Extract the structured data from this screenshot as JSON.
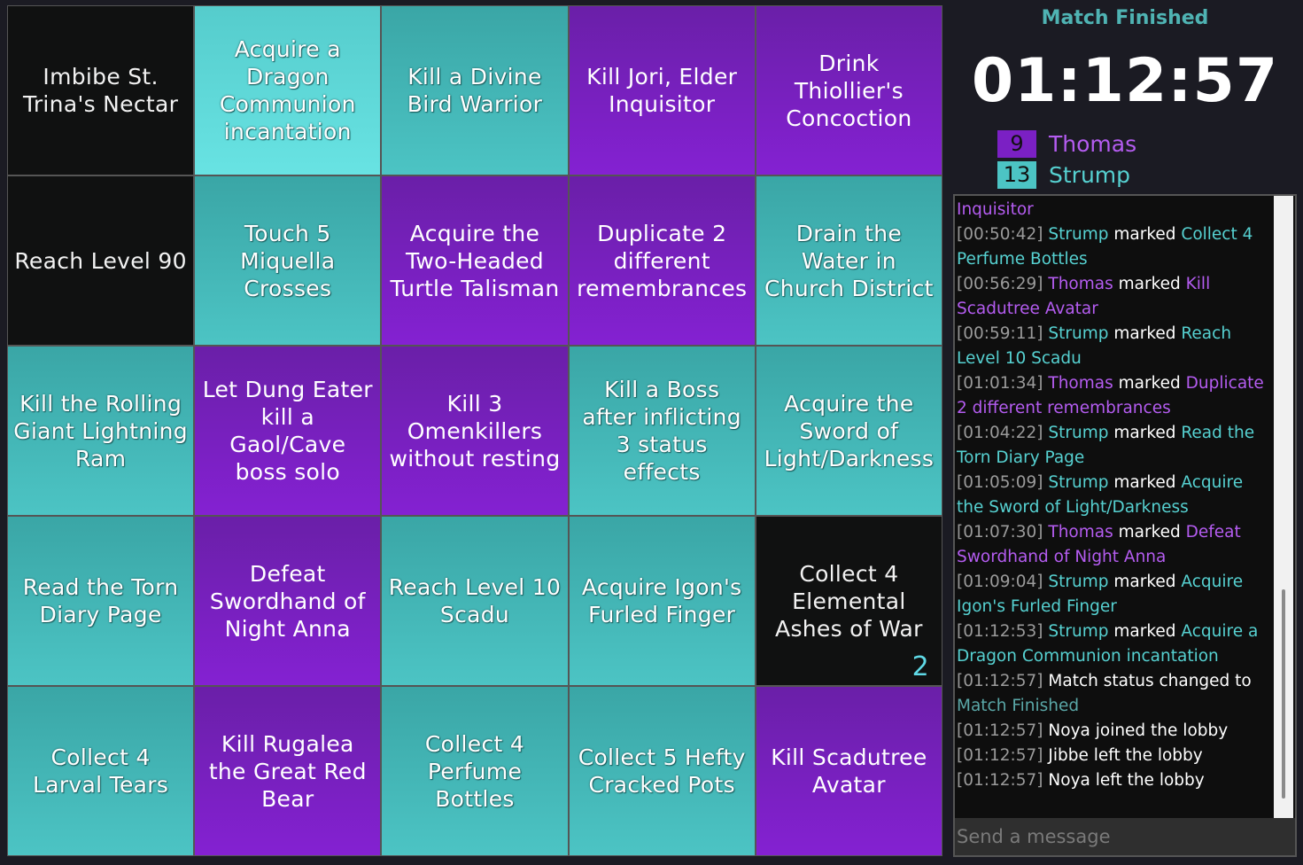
{
  "colors": {
    "teal": "#4cc4c4",
    "purple": "#7b20c4",
    "unmarked": "#101111",
    "timer": "#ffffff",
    "status": "#4fb3b3"
  },
  "board": [
    {
      "text": "Imbibe St. Trina's Nectar",
      "owner": "none"
    },
    {
      "text": "Acquire a Dragon Communion incantation",
      "owner": "teal-light"
    },
    {
      "text": "Kill a Divine Bird Warrior",
      "owner": "teal"
    },
    {
      "text": "Kill Jori, Elder Inquisitor",
      "owner": "purple"
    },
    {
      "text": "Drink Thiollier's Concoction",
      "owner": "purple"
    },
    {
      "text": "Reach Level 90",
      "owner": "none"
    },
    {
      "text": "Touch 5 Miquella Crosses",
      "owner": "teal"
    },
    {
      "text": "Acquire the Two-Headed Turtle Talisman",
      "owner": "purple"
    },
    {
      "text": "Duplicate 2 different remembrances",
      "owner": "purple"
    },
    {
      "text": "Drain the Water in Church District",
      "owner": "teal"
    },
    {
      "text": "Kill the Rolling Giant Lightning Ram",
      "owner": "teal"
    },
    {
      "text": "Let Dung Eater kill a Gaol/Cave boss solo",
      "owner": "purple"
    },
    {
      "text": "Kill 3 Omenkillers without resting",
      "owner": "purple"
    },
    {
      "text": "Kill a Boss after inflicting 3 status effects",
      "owner": "teal"
    },
    {
      "text": "Acquire the Sword of Light/Darkness",
      "owner": "teal"
    },
    {
      "text": "Read the Torn Diary Page",
      "owner": "teal"
    },
    {
      "text": "Defeat Swordhand of Night Anna",
      "owner": "purple"
    },
    {
      "text": "Reach Level 10 Scadu",
      "owner": "teal"
    },
    {
      "text": "Acquire Igon's Furled Finger",
      "owner": "teal"
    },
    {
      "text": "Collect 4 Elemental Ashes of War",
      "owner": "none",
      "counter": "2"
    },
    {
      "text": "Collect 4 Larval Tears",
      "owner": "teal"
    },
    {
      "text": "Kill Rugalea the Great Red Bear",
      "owner": "purple"
    },
    {
      "text": "Collect 4 Perfume Bottles",
      "owner": "teal"
    },
    {
      "text": "Collect 5 Hefty Cracked Pots",
      "owner": "teal"
    },
    {
      "text": "Kill Scadutree Avatar",
      "owner": "purple"
    }
  ],
  "sidebar": {
    "status": "Match Finished",
    "timer": "01:12:57",
    "players": [
      {
        "name": "Thomas",
        "score": "9",
        "color": "#7b20c4",
        "text_color": "#b45cf0"
      },
      {
        "name": "Strump",
        "score": "13",
        "color": "#4cc4c4",
        "text_color": "#56d1d1"
      }
    ]
  },
  "chat": {
    "placeholder": "Send a message",
    "messages": [
      {
        "parts": [
          {
            "t": "Inquisitor",
            "c": "purple"
          }
        ]
      },
      {
        "parts": [
          {
            "t": "[00:50:42] ",
            "c": "ts"
          },
          {
            "t": "Strump",
            "c": "teal"
          },
          {
            "t": " marked ",
            "c": "plain"
          },
          {
            "t": "Collect 4 Perfume Bottles",
            "c": "teal"
          }
        ]
      },
      {
        "parts": [
          {
            "t": "[00:56:29] ",
            "c": "ts"
          },
          {
            "t": "Thomas",
            "c": "purple"
          },
          {
            "t": " marked ",
            "c": "plain"
          },
          {
            "t": "Kill Scadutree Avatar",
            "c": "purple"
          }
        ]
      },
      {
        "parts": [
          {
            "t": "[00:59:11] ",
            "c": "ts"
          },
          {
            "t": "Strump",
            "c": "teal"
          },
          {
            "t": " marked ",
            "c": "plain"
          },
          {
            "t": "Reach Level 10 Scadu",
            "c": "teal"
          }
        ]
      },
      {
        "parts": [
          {
            "t": "[01:01:34] ",
            "c": "ts"
          },
          {
            "t": "Thomas",
            "c": "purple"
          },
          {
            "t": " marked ",
            "c": "plain"
          },
          {
            "t": "Duplicate 2 different remembrances",
            "c": "purple"
          }
        ]
      },
      {
        "parts": [
          {
            "t": "[01:04:22] ",
            "c": "ts"
          },
          {
            "t": "Strump",
            "c": "teal"
          },
          {
            "t": " marked ",
            "c": "plain"
          },
          {
            "t": "Read the Torn Diary Page",
            "c": "teal"
          }
        ]
      },
      {
        "parts": [
          {
            "t": "[01:05:09] ",
            "c": "ts"
          },
          {
            "t": "Strump",
            "c": "teal"
          },
          {
            "t": " marked ",
            "c": "plain"
          },
          {
            "t": "Acquire the Sword of Light/Darkness",
            "c": "teal"
          }
        ]
      },
      {
        "parts": [
          {
            "t": "[01:07:30] ",
            "c": "ts"
          },
          {
            "t": "Thomas",
            "c": "purple"
          },
          {
            "t": " marked ",
            "c": "plain"
          },
          {
            "t": "Defeat Swordhand of Night Anna",
            "c": "purple"
          }
        ]
      },
      {
        "parts": [
          {
            "t": "[01:09:04] ",
            "c": "ts"
          },
          {
            "t": "Strump",
            "c": "teal"
          },
          {
            "t": " marked ",
            "c": "plain"
          },
          {
            "t": "Acquire Igon's Furled Finger",
            "c": "teal"
          }
        ]
      },
      {
        "parts": [
          {
            "t": "[01:12:53] ",
            "c": "ts"
          },
          {
            "t": "Strump",
            "c": "teal"
          },
          {
            "t": " marked ",
            "c": "plain"
          },
          {
            "t": "Acquire a Dragon Communion incantation",
            "c": "teal"
          }
        ]
      },
      {
        "parts": [
          {
            "t": "[01:12:57] ",
            "c": "ts"
          },
          {
            "t": "Match status changed to ",
            "c": "plain"
          },
          {
            "t": "Match Finished",
            "c": "status"
          }
        ]
      },
      {
        "parts": [
          {
            "t": "[01:12:57] ",
            "c": "ts"
          },
          {
            "t": "Noya joined the lobby",
            "c": "plain"
          }
        ]
      },
      {
        "parts": [
          {
            "t": "[01:12:57] ",
            "c": "ts"
          },
          {
            "t": "Jibbe left the lobby",
            "c": "plain"
          }
        ]
      },
      {
        "parts": [
          {
            "t": "[01:12:57] ",
            "c": "ts"
          },
          {
            "t": "Noya left the lobby",
            "c": "plain"
          }
        ]
      }
    ]
  }
}
